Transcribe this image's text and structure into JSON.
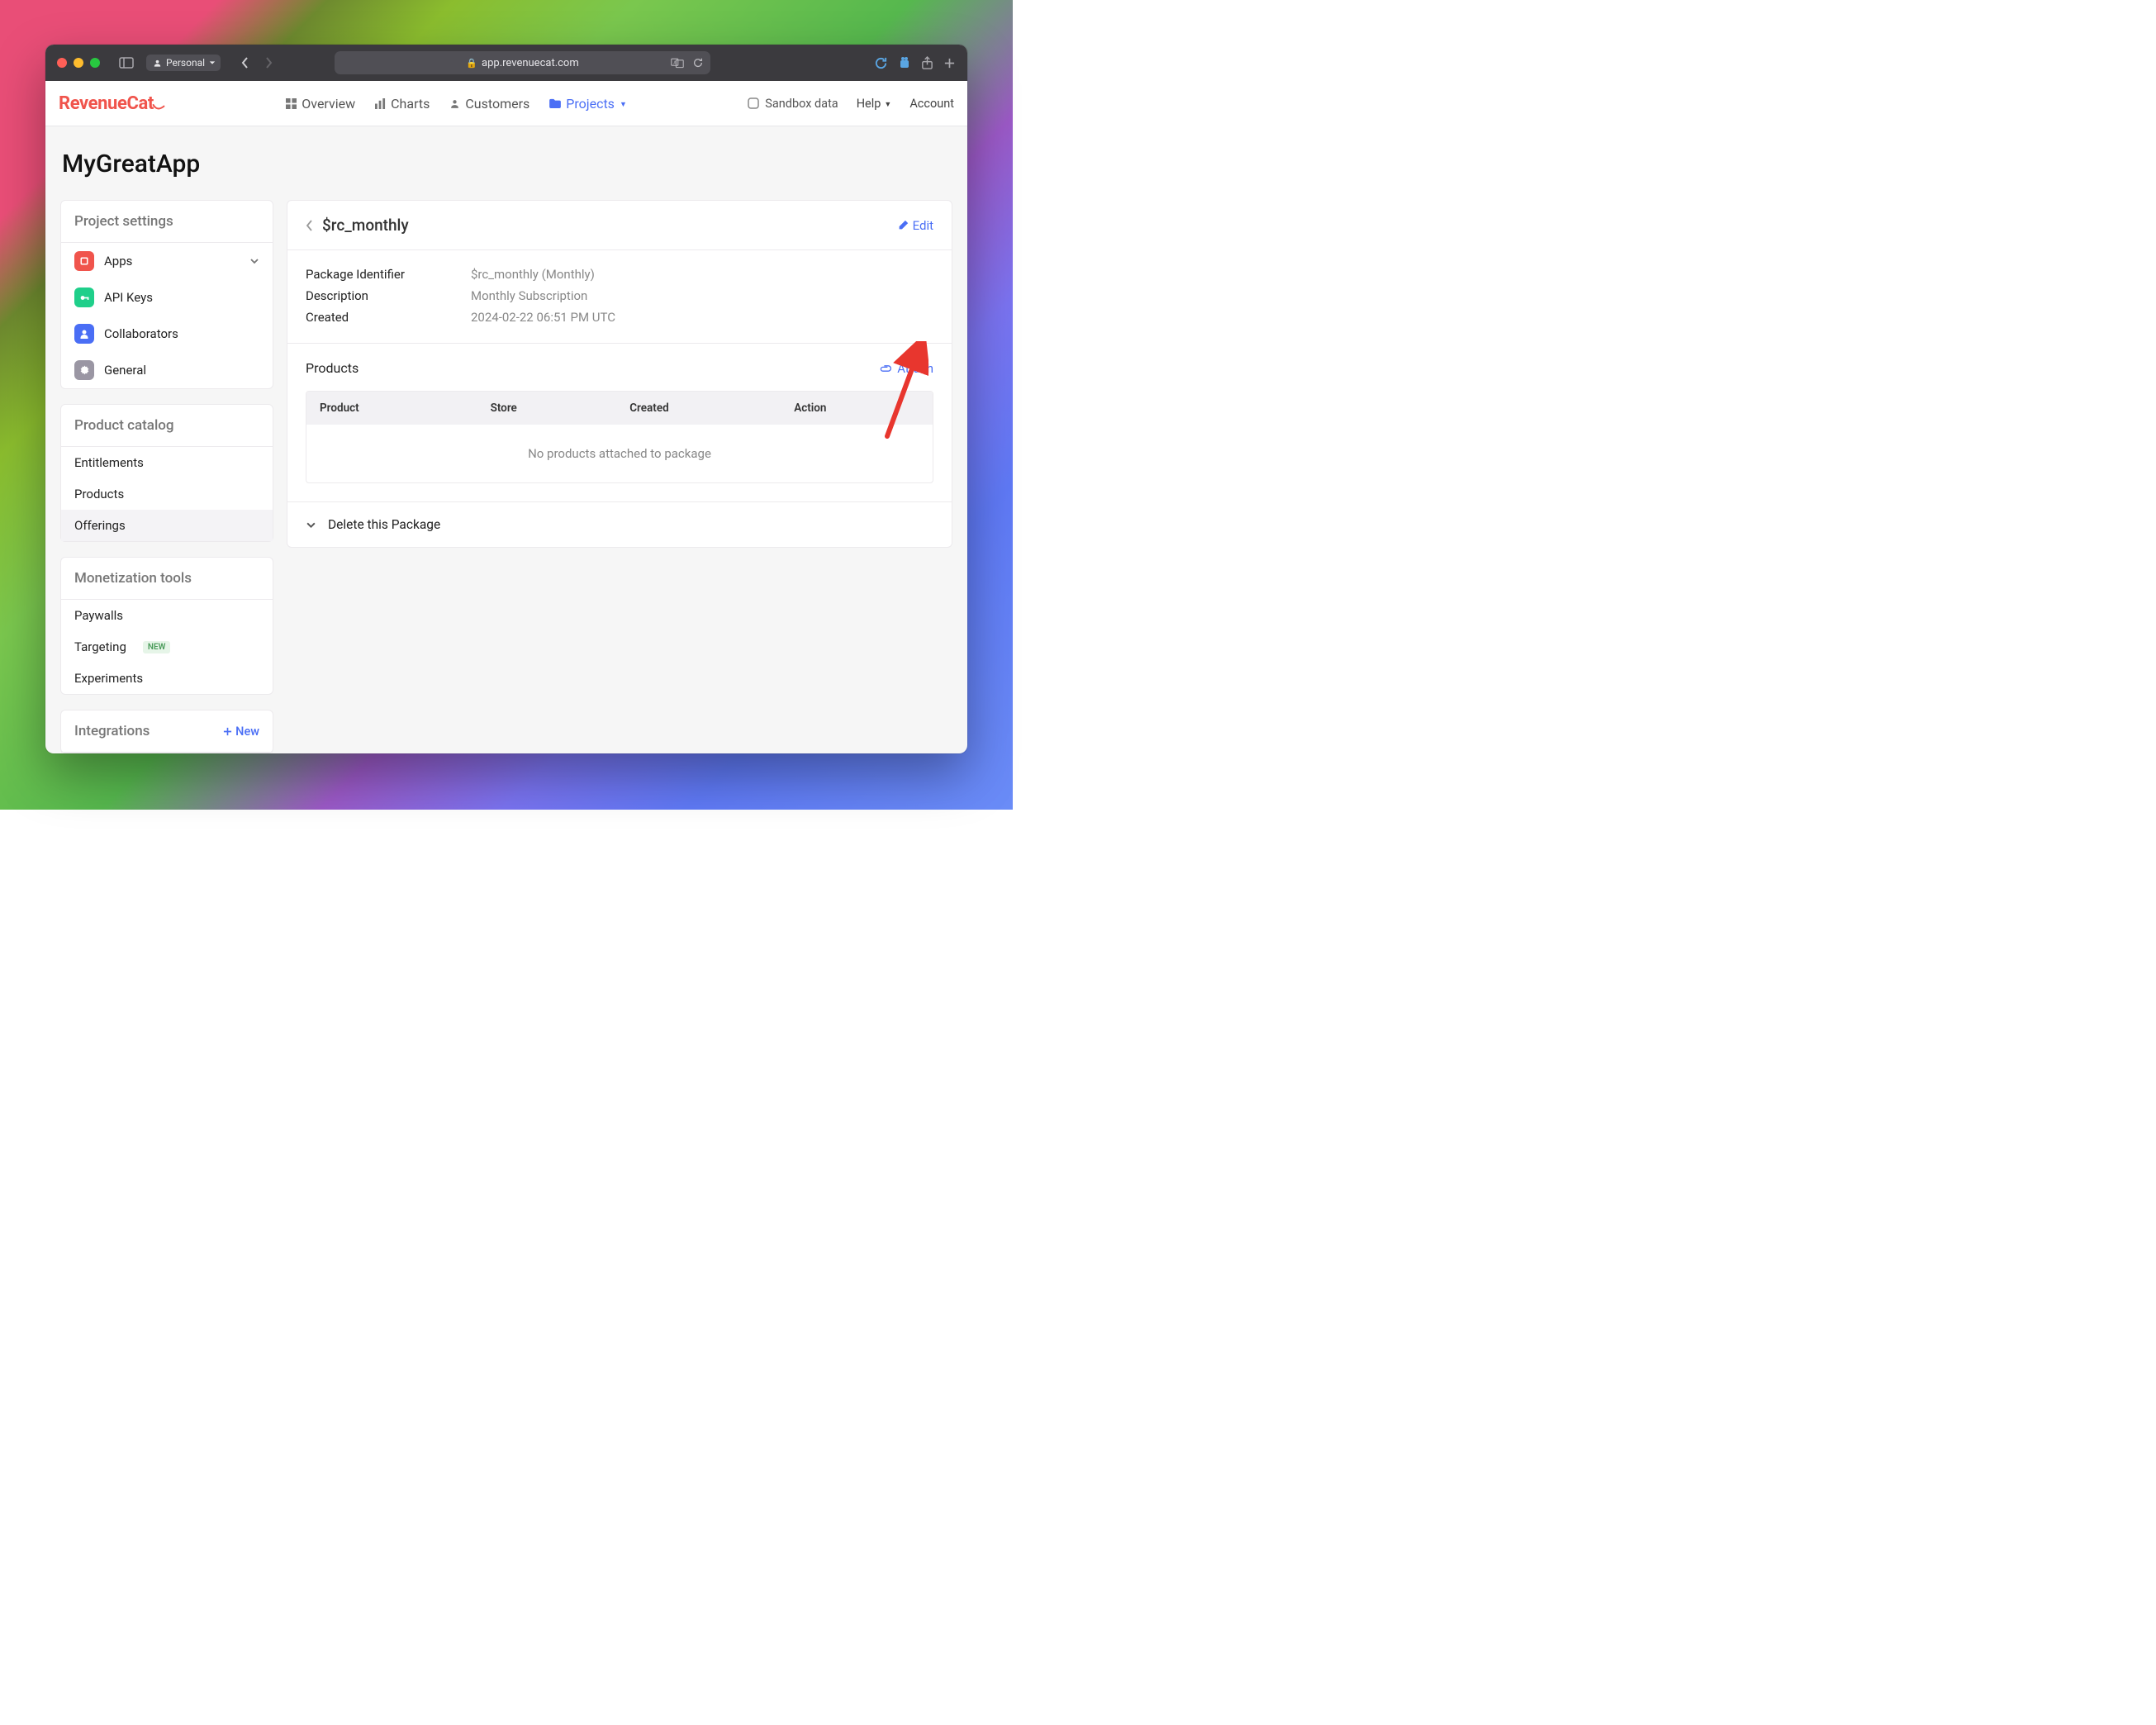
{
  "browser": {
    "profile": "Personal",
    "url": "app.revenuecat.com"
  },
  "header": {
    "logo": "RevenueCat",
    "nav": {
      "overview": "Overview",
      "charts": "Charts",
      "customers": "Customers",
      "projects": "Projects"
    },
    "sandbox": "Sandbox data",
    "help": "Help",
    "account": "Account"
  },
  "page_title": "MyGreatApp",
  "sidebar": {
    "project_settings": {
      "title": "Project settings",
      "apps": "Apps",
      "api_keys": "API Keys",
      "collaborators": "Collaborators",
      "general": "General"
    },
    "product_catalog": {
      "title": "Product catalog",
      "entitlements": "Entitlements",
      "products": "Products",
      "offerings": "Offerings"
    },
    "monetization": {
      "title": "Monetization tools",
      "paywalls": "Paywalls",
      "targeting": "Targeting",
      "targeting_badge": "NEW",
      "experiments": "Experiments"
    },
    "integrations": {
      "title": "Integrations",
      "new": "New"
    }
  },
  "panel": {
    "title": "$rc_monthly",
    "edit": "Edit",
    "kv": {
      "package_id_label": "Package Identifier",
      "package_id_value": "$rc_monthly (Monthly)",
      "description_label": "Description",
      "description_value": "Monthly Subscription",
      "created_label": "Created",
      "created_value": "2024-02-22 06:51 PM UTC"
    },
    "products": {
      "title": "Products",
      "attach": "Attach",
      "cols": {
        "product": "Product",
        "store": "Store",
        "created": "Created",
        "action": "Action"
      },
      "empty": "No products attached to package"
    },
    "delete": "Delete this Package"
  }
}
